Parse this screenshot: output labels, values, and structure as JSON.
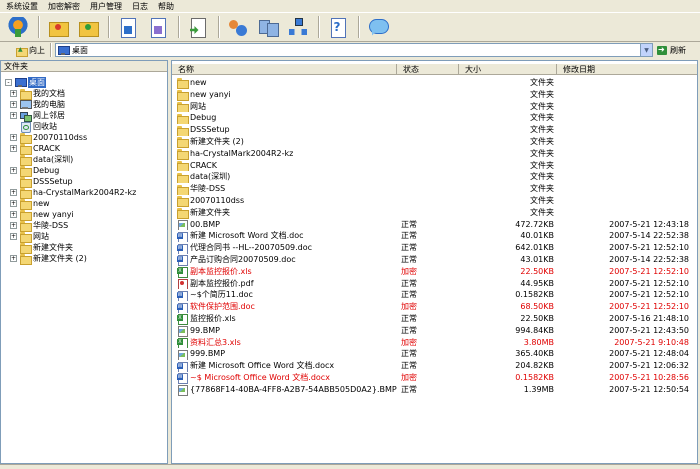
{
  "menubar": {
    "items": [
      "系统设置",
      "加密解密",
      "用户管理",
      "日志",
      "帮助"
    ]
  },
  "toolbar": {
    "buttons": [
      "shield-icon",
      "folder-lock-icon",
      "folder-unlock-icon",
      "doc-lock-icon",
      "doc-unlock-icon",
      "export-icon",
      "users-icon",
      "computers-icon",
      "network-icon",
      "help-icon",
      "chat-icon"
    ]
  },
  "address": {
    "up_label": "向上",
    "path": "桌面",
    "refresh_label": "刷新"
  },
  "tree": {
    "title": "文件夹",
    "items": [
      {
        "label": "桌面",
        "icon": "desktop-icon",
        "expander": "-",
        "selected": true
      },
      {
        "label": "我的文档",
        "icon": "folder-icon",
        "expander": "+"
      },
      {
        "label": "我的电脑",
        "icon": "computer-icon",
        "expander": "+"
      },
      {
        "label": "网上邻居",
        "icon": "network-icon",
        "expander": "+"
      },
      {
        "label": "回收站",
        "icon": "recycle-icon",
        "expander": ""
      },
      {
        "label": "20070110dss",
        "icon": "folder-icon",
        "expander": "+"
      },
      {
        "label": "CRACK",
        "icon": "folder-icon",
        "expander": "+"
      },
      {
        "label": "data(深圳)",
        "icon": "folder-icon",
        "expander": ""
      },
      {
        "label": "Debug",
        "icon": "folder-icon",
        "expander": "+"
      },
      {
        "label": "DSSSetup",
        "icon": "folder-icon",
        "expander": ""
      },
      {
        "label": "ha-CrystalMark2004R2-kz",
        "icon": "folder-icon",
        "expander": "+"
      },
      {
        "label": "new",
        "icon": "folder-icon",
        "expander": "+"
      },
      {
        "label": "new yanyi",
        "icon": "folder-icon",
        "expander": "+"
      },
      {
        "label": "华陵-DSS",
        "icon": "folder-icon",
        "expander": "+"
      },
      {
        "label": "网站",
        "icon": "folder-icon",
        "expander": "+"
      },
      {
        "label": "新建文件夹",
        "icon": "folder-icon",
        "expander": ""
      },
      {
        "label": "新建文件夹 (2)",
        "icon": "folder-icon",
        "expander": "+"
      }
    ]
  },
  "list": {
    "columns": [
      "名称",
      "状态",
      "大小",
      "修改日期"
    ],
    "rows": [
      {
        "name": "new",
        "icon": "folder-icon",
        "status": "",
        "size": "文件夹",
        "date": "",
        "encrypted": false
      },
      {
        "name": "new yanyi",
        "icon": "folder-icon",
        "status": "",
        "size": "文件夹",
        "date": "",
        "encrypted": false
      },
      {
        "name": "网站",
        "icon": "folder-icon",
        "status": "",
        "size": "文件夹",
        "date": "",
        "encrypted": false
      },
      {
        "name": "Debug",
        "icon": "folder-icon",
        "status": "",
        "size": "文件夹",
        "date": "",
        "encrypted": false
      },
      {
        "name": "DSSSetup",
        "icon": "folder-icon",
        "status": "",
        "size": "文件夹",
        "date": "",
        "encrypted": false
      },
      {
        "name": "新建文件夹 (2)",
        "icon": "folder-icon",
        "status": "",
        "size": "文件夹",
        "date": "",
        "encrypted": false
      },
      {
        "name": "ha-CrystalMark2004R2-kz",
        "icon": "folder-icon",
        "status": "",
        "size": "文件夹",
        "date": "",
        "encrypted": false
      },
      {
        "name": "CRACK",
        "icon": "folder-icon",
        "status": "",
        "size": "文件夹",
        "date": "",
        "encrypted": false
      },
      {
        "name": "data(深圳)",
        "icon": "folder-icon",
        "status": "",
        "size": "文件夹",
        "date": "",
        "encrypted": false
      },
      {
        "name": "华陵-DSS",
        "icon": "folder-icon",
        "status": "",
        "size": "文件夹",
        "date": "",
        "encrypted": false
      },
      {
        "name": "20070110dss",
        "icon": "folder-icon",
        "status": "",
        "size": "文件夹",
        "date": "",
        "encrypted": false
      },
      {
        "name": "新建文件夹",
        "icon": "folder-icon",
        "status": "",
        "size": "文件夹",
        "date": "",
        "encrypted": false
      },
      {
        "name": "00.BMP",
        "icon": "bmp-icon",
        "status": "正常",
        "size": "472.72KB",
        "date": "2007-5-21 12:43:18",
        "encrypted": false
      },
      {
        "name": "新建 Microsoft Word 文档.doc",
        "icon": "doc-icon",
        "status": "正常",
        "size": "40.01KB",
        "date": "2007-5-14 22:52:38",
        "encrypted": false
      },
      {
        "name": "代理合同书 --HL--20070509.doc",
        "icon": "doc-icon",
        "status": "正常",
        "size": "642.01KB",
        "date": "2007-5-21 12:52:10",
        "encrypted": false
      },
      {
        "name": "产品订购合同20070509.doc",
        "icon": "doc-icon",
        "status": "正常",
        "size": "43.01KB",
        "date": "2007-5-14 22:52:38",
        "encrypted": false
      },
      {
        "name": "副本监控报价.xls",
        "icon": "xls-icon",
        "status": "加密",
        "size": "22.50KB",
        "date": "2007-5-21 12:52:10",
        "encrypted": true
      },
      {
        "name": "副本监控报价.pdf",
        "icon": "pdf-icon",
        "status": "正常",
        "size": "44.95KB",
        "date": "2007-5-21 12:52:10",
        "encrypted": false
      },
      {
        "name": "~$个简历11.doc",
        "icon": "doc-icon",
        "status": "正常",
        "size": "0.1582KB",
        "date": "2007-5-21 12:52:10",
        "encrypted": false
      },
      {
        "name": "软件保护范围.doc",
        "icon": "doc-icon",
        "status": "加密",
        "size": "68.50KB",
        "date": "2007-5-21 12:52:10",
        "encrypted": true
      },
      {
        "name": "监控报价.xls",
        "icon": "xls-icon",
        "status": "正常",
        "size": "22.50KB",
        "date": "2007-5-16 21:48:10",
        "encrypted": false
      },
      {
        "name": "99.BMP",
        "icon": "bmp-icon",
        "status": "正常",
        "size": "994.84KB",
        "date": "2007-5-21 12:43:50",
        "encrypted": false
      },
      {
        "name": "资料汇总3.xls",
        "icon": "xls-icon",
        "status": "加密",
        "size": "3.80MB",
        "date": "2007-5-21 9:10:48",
        "encrypted": true
      },
      {
        "name": "999.BMP",
        "icon": "bmp-icon",
        "status": "正常",
        "size": "365.40KB",
        "date": "2007-5-21 12:48:04",
        "encrypted": false
      },
      {
        "name": "新建 Microsoft Office Word 文档.docx",
        "icon": "doc-icon",
        "status": "正常",
        "size": "204.82KB",
        "date": "2007-5-21 12:06:32",
        "encrypted": false
      },
      {
        "name": "~$ Microsoft Office Word 文档.docx",
        "icon": "doc-icon",
        "status": "加密",
        "size": "0.1582KB",
        "date": "2007-5-21 10:28:56",
        "encrypted": true
      },
      {
        "name": "{77868F14-40BA-4FF8-A2B7-54ABB505D0A2}.BMP",
        "icon": "bmp-icon",
        "status": "正常",
        "size": "1.39MB",
        "date": "2007-5-21 12:50:54",
        "encrypted": false
      }
    ]
  },
  "colors": {
    "encrypted": "#e00000",
    "selection": "#316ac5",
    "chrome": "#ece9d8"
  }
}
